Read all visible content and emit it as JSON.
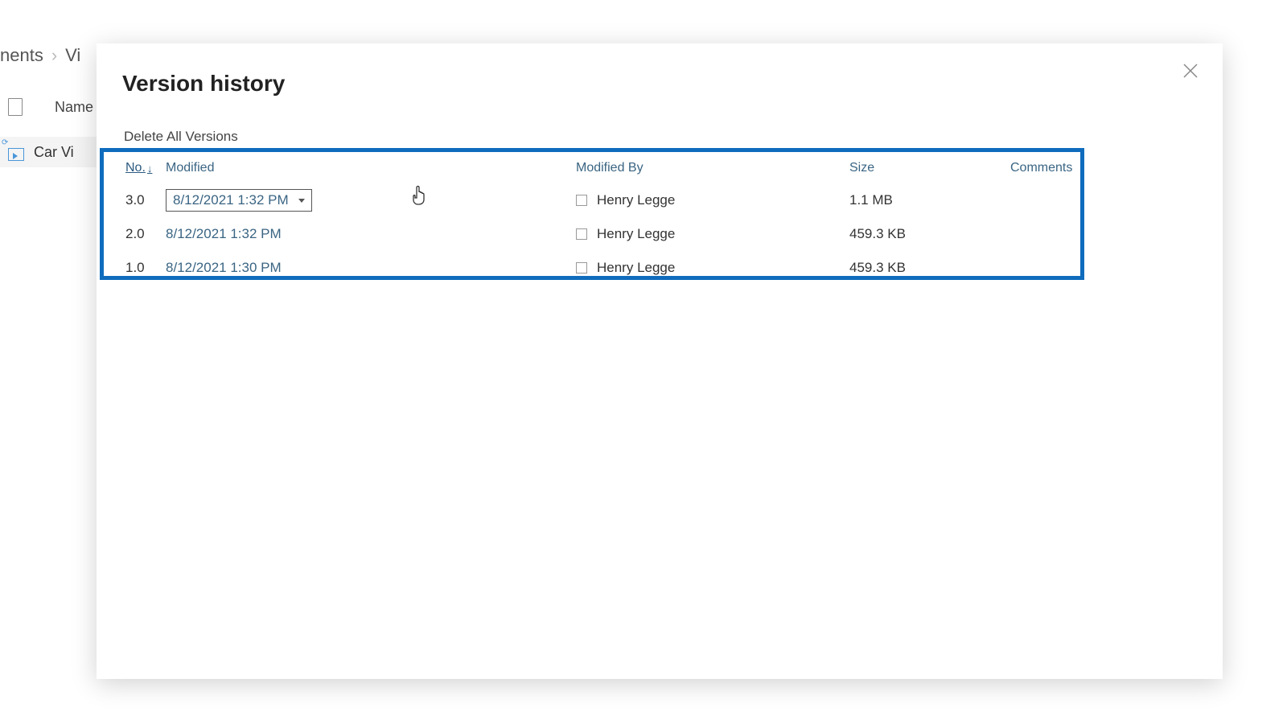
{
  "background": {
    "breadcrumb_fragment_1": "nents",
    "breadcrumb_fragment_2": "Vi",
    "name_column": "Name",
    "file_name_fragment": "Car Vi"
  },
  "dialog": {
    "title": "Version history",
    "delete_all": "Delete All Versions",
    "columns": {
      "no": "No.",
      "modified": "Modified",
      "modified_by": "Modified By",
      "size": "Size",
      "comments": "Comments"
    },
    "rows": [
      {
        "no": "3.0",
        "modified": "8/12/2021 1:32 PM",
        "modified_by": "Henry Legge",
        "size": "1.1 MB"
      },
      {
        "no": "2.0",
        "modified": "8/12/2021 1:32 PM",
        "modified_by": "Henry Legge",
        "size": "459.3 KB"
      },
      {
        "no": "1.0",
        "modified": "8/12/2021 1:30 PM",
        "modified_by": "Henry Legge",
        "size": "459.3 KB"
      }
    ]
  }
}
